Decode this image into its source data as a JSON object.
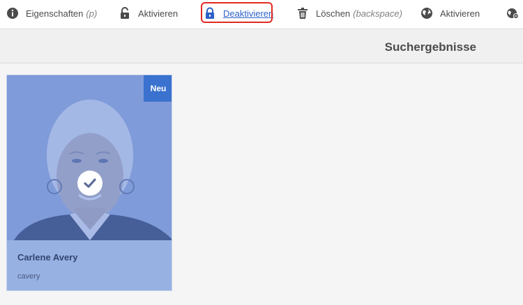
{
  "toolbar": {
    "items": [
      {
        "label": "Eigenschaften",
        "shortcut": "(p)",
        "icon": "info-circle-icon"
      },
      {
        "label": "Aktivieren",
        "shortcut": "",
        "icon": "lock-open-icon"
      },
      {
        "label": "Deaktivieren",
        "shortcut": "",
        "icon": "lock-closed-icon"
      },
      {
        "label": "Löschen",
        "shortcut": "(backspace)",
        "icon": "trash-icon"
      },
      {
        "label": "Aktivieren",
        "shortcut": "",
        "icon": "globe-icon"
      },
      {
        "label": "",
        "shortcut": "",
        "icon": "globe-remove-icon"
      }
    ]
  },
  "header": {
    "title": "Suchergebnisse"
  },
  "results": {
    "cards": [
      {
        "badge": "Neu",
        "name": "Carlene Avery",
        "username": "cavery",
        "selected": true
      }
    ]
  },
  "colors": {
    "accent": "#2d61c7",
    "highlight": "#e02b20",
    "badge": "#3b72cf",
    "card_info": "#97b1e3"
  }
}
